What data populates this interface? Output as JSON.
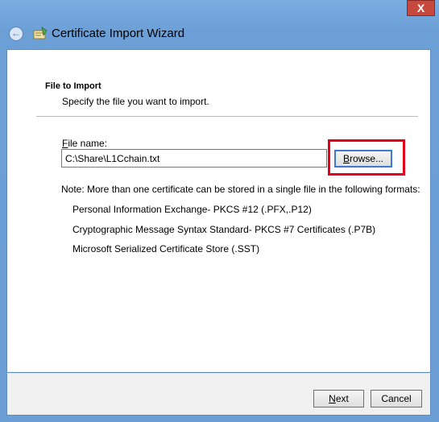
{
  "window": {
    "title": "Certificate Import Wizard",
    "close_glyph": "X",
    "back_glyph": "←"
  },
  "section": {
    "heading": "File to Import",
    "subheading": "Specify the file you want to import."
  },
  "file": {
    "label_first": "F",
    "label_rest": "ile name:",
    "value": "C:\\Share\\L1Cchain.txt"
  },
  "browse": {
    "accel": "B",
    "rest": "rowse..."
  },
  "note": "Note:  More than one certificate can be stored in a single file in the following formats:",
  "formats": [
    "Personal Information Exchange- PKCS #12 (.PFX,.P12)",
    "Cryptographic Message Syntax Standard- PKCS #7 Certificates (.P7B)",
    "Microsoft Serialized Certificate Store (.SST)"
  ],
  "footer": {
    "next_accel": "N",
    "next_rest": "ext",
    "cancel_label": "Cancel"
  },
  "colors": {
    "highlight": "#e2001a",
    "frame": "#6b9fd6"
  }
}
